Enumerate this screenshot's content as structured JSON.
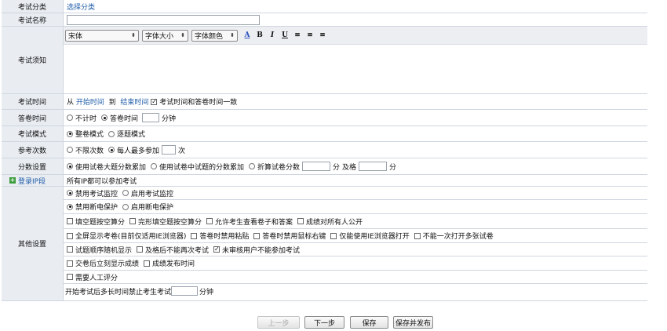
{
  "category": {
    "label": "考试分类",
    "link": "选择分类"
  },
  "name": {
    "label": "考试名称",
    "value": ""
  },
  "notes": {
    "label": "考试须知",
    "toolbar": {
      "font": "宋体",
      "size": "字体大小",
      "color": "字体颜色"
    },
    "content": ""
  },
  "time": {
    "label": "考试时间",
    "from": "从",
    "start": "开始时间",
    "to": "到",
    "end": "结束时间",
    "same_label": "考试时间和答卷时间一致"
  },
  "answer_time": {
    "label": "答卷时间",
    "opt1": "不计时",
    "opt2": "答卷时间",
    "value": "",
    "unit": "分钟"
  },
  "mode": {
    "label": "考试模式",
    "opt1": "整卷模式",
    "opt2": "逐题模式"
  },
  "attempts": {
    "label": "参考次数",
    "opt1": "不限次数",
    "opt2": "每人最多参加",
    "value": "",
    "unit": "次"
  },
  "score": {
    "label": "分数设置",
    "opt1": "使用试卷大题分数累加",
    "opt2": "使用试卷中试题的分数累加",
    "opt3": "折算试卷分数",
    "unit1": "分",
    "pass_label": "及格",
    "unit2": "分"
  },
  "ip": {
    "label": "登录IP段",
    "text": "所有IP都可以参加考试"
  },
  "other": {
    "label": "其他设置",
    "monitor": {
      "opt1": "禁用考试监控",
      "opt2": "启用考试监控"
    },
    "power": {
      "opt1": "禁用断电保护",
      "opt2": "启用断电保护"
    },
    "checks1": [
      "填空题按空算分",
      "完形填空题按空算分",
      "允许考生查看卷子和答案",
      "成绩对所有人公开"
    ],
    "checks2": [
      "全屏显示考卷(目前仅适用IE浏览器)",
      "答卷时禁用粘贴",
      "答卷时禁用鼠标右键",
      "仅能使用IE浏览器打开",
      "不能一次打开多张试卷"
    ],
    "checks3": [
      "试题顺序随机显示",
      "及格后不能再次考试",
      "未审核用户不能参加考试"
    ],
    "checks4": [
      "交卷后立刻显示成绩",
      "成绩发布时间"
    ],
    "checks5": [
      "需要人工评分"
    ],
    "late_label": "开始考试后多长时间禁止考生考试",
    "late_value": "",
    "late_unit": "分钟"
  },
  "buttons": {
    "prev": "上一步",
    "next": "下一步",
    "save": "保存",
    "save_publish": "保存并发布"
  },
  "colors": {
    "label_bg": "#e9edf2",
    "border": "#cfd6e0",
    "link": "#1f5ca8"
  }
}
